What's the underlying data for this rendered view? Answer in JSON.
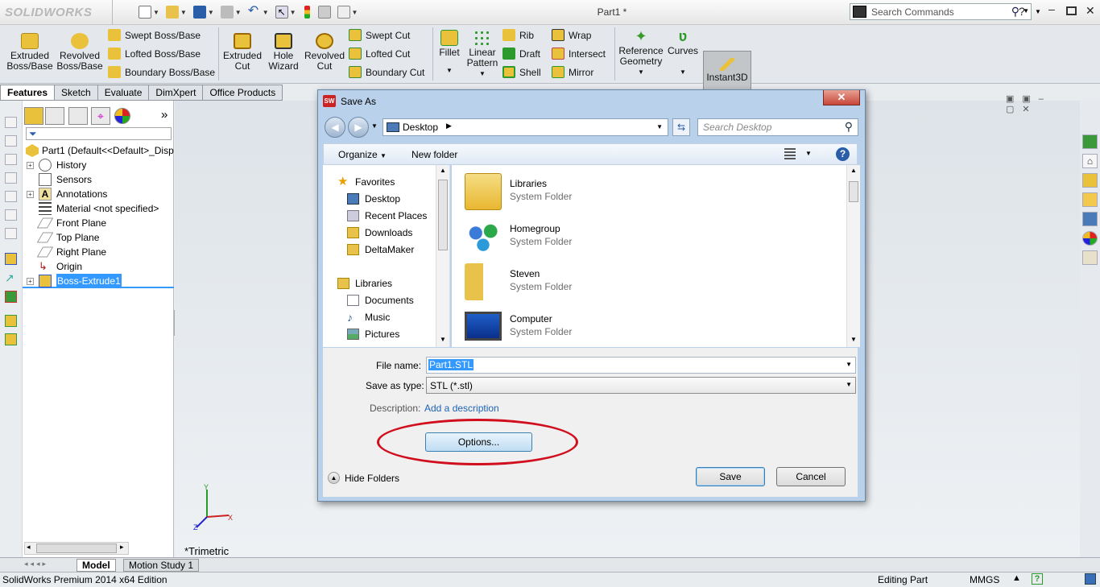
{
  "app": {
    "brand": "SOLIDWORKS",
    "document_title": "Part1 *",
    "search_placeholder": "Search Commands",
    "help_label": "?"
  },
  "ribbon": {
    "extruded_boss": "Extruded\nBoss/Base",
    "revolved_boss": "Revolved\nBoss/Base",
    "swept_boss": "Swept Boss/Base",
    "lofted_boss": "Lofted Boss/Base",
    "boundary_boss": "Boundary Boss/Base",
    "extruded_cut": "Extruded\nCut",
    "hole_wizard": "Hole\nWizard",
    "revolved_cut": "Revolved\nCut",
    "swept_cut": "Swept Cut",
    "lofted_cut": "Lofted Cut",
    "boundary_cut": "Boundary Cut",
    "fillet": "Fillet",
    "linear_pattern": "Linear\nPattern",
    "rib": "Rib",
    "draft": "Draft",
    "shell": "Shell",
    "wrap": "Wrap",
    "intersect": "Intersect",
    "mirror": "Mirror",
    "reference_geometry": "Reference\nGeometry",
    "curves": "Curves",
    "instant3d": "Instant3D"
  },
  "tabs": [
    "Features",
    "Sketch",
    "Evaluate",
    "DimXpert",
    "Office Products"
  ],
  "feature_tree": {
    "root": "Part1  (Default<<Default>_Disp",
    "items": [
      {
        "label": "History",
        "expandable": true
      },
      {
        "label": "Sensors",
        "expandable": false
      },
      {
        "label": "Annotations",
        "expandable": true
      },
      {
        "label": "Material <not specified>",
        "expandable": false
      },
      {
        "label": "Front Plane",
        "expandable": false
      },
      {
        "label": "Top Plane",
        "expandable": false
      },
      {
        "label": "Right Plane",
        "expandable": false
      },
      {
        "label": "Origin",
        "expandable": false
      },
      {
        "label": "Boss-Extrude1",
        "expandable": true,
        "selected": true
      }
    ],
    "more": "»"
  },
  "viewport": {
    "view_name": "*Trimetric",
    "triad": {
      "x": "X",
      "y": "Y",
      "z": "Z"
    }
  },
  "bottom_tabs": [
    "Model",
    "Motion Study 1"
  ],
  "status": {
    "edition": "SolidWorks Premium 2014 x64 Edition",
    "mode": "Editing Part",
    "units": "MMGS",
    "help": "?"
  },
  "dialog": {
    "title": "Save As",
    "close": "✕",
    "location": "Desktop",
    "search_placeholder": "Search Desktop",
    "organize": "Organize",
    "new_folder": "New folder",
    "nav": {
      "favorites": "Favorites",
      "favorite_items": [
        "Desktop",
        "Recent Places",
        "Downloads",
        "DeltaMaker"
      ],
      "libraries": "Libraries",
      "library_items": [
        "Documents",
        "Music",
        "Pictures"
      ]
    },
    "files": [
      {
        "name": "Libraries",
        "type": "System Folder"
      },
      {
        "name": "Homegroup",
        "type": "System Folder"
      },
      {
        "name": "Steven",
        "type": "System Folder"
      },
      {
        "name": "Computer",
        "type": "System Folder"
      }
    ],
    "file_name_label": "File name:",
    "file_name_value": "Part1.STL",
    "save_type_label": "Save as type:",
    "save_type_value": "STL (*.stl)",
    "description_label": "Description:",
    "description_link": "Add a description",
    "options_button": "Options...",
    "hide_folders": "Hide Folders",
    "save_button": "Save",
    "cancel_button": "Cancel"
  },
  "colors": {
    "annotation_oval": "#d10e1e",
    "selection": "#3399ff",
    "link": "#1e62b6"
  }
}
